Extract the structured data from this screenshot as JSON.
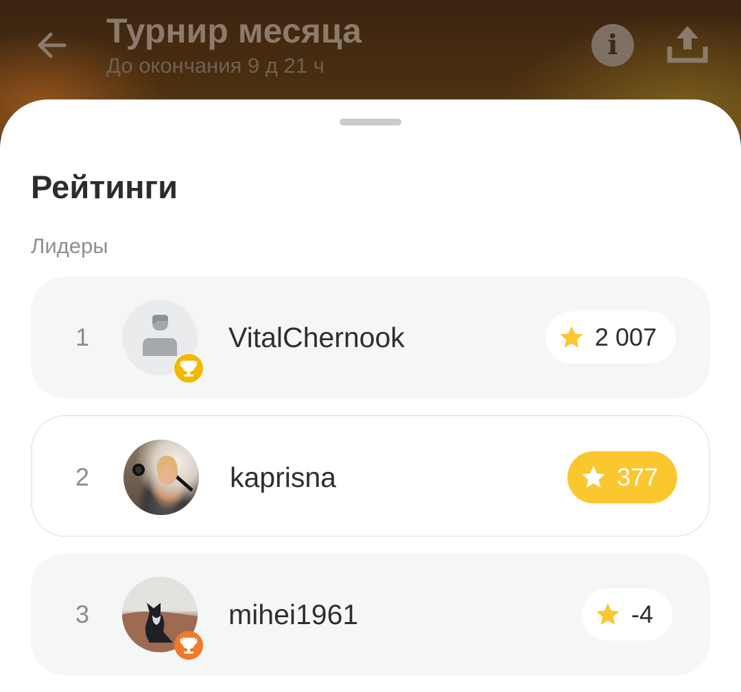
{
  "header": {
    "title": "Турнир месяца",
    "subtitle": "До окончания 9 д 21 ч",
    "info_icon_glyph": "i"
  },
  "sheet": {
    "title": "Рейтинги",
    "section_label": "Лидеры"
  },
  "leaders": [
    {
      "rank": "1",
      "username": "VitalChernook",
      "score": "2 007",
      "avatar": "default-avatar",
      "trophy": "gold",
      "highlight": false
    },
    {
      "rank": "2",
      "username": "kaprisna",
      "score": "377",
      "avatar": "photo",
      "trophy": "none",
      "highlight": true
    },
    {
      "rank": "3",
      "username": "mihei1961",
      "score": "-4",
      "avatar": "photo",
      "trophy": "bronze",
      "highlight": false
    }
  ],
  "colors": {
    "accent_yellow": "#fbc72e",
    "trophy_gold": "#f5b800",
    "trophy_bronze": "#ef7a2a",
    "star": "#fbc72e"
  }
}
